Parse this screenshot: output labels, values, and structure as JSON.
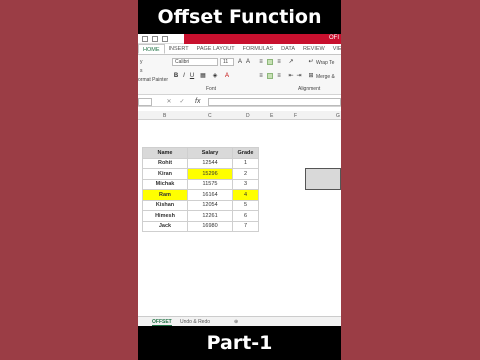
{
  "title": "Offset Function",
  "footer": "Part-1",
  "ribbon_tabs": [
    "HOME",
    "INSERT",
    "PAGE LAYOUT",
    "FORMULAS",
    "DATA",
    "REVIEW",
    "VIEW"
  ],
  "qat_tag": "OFI",
  "ribbon": {
    "font_name": "Calibri",
    "font_size": "11",
    "font_group": "Font",
    "alignment_group": "Alignment",
    "wrap_text": "Wrap Te",
    "merge": "Merge &",
    "paste_partial_1": "y",
    "paste_partial_2": "ormat Painter",
    "clipboard_partial": "s"
  },
  "formula_bar": {
    "fx": "fx"
  },
  "columns": [
    "B",
    "C",
    "D",
    "E",
    "F",
    "G"
  ],
  "table": {
    "headers": [
      "Name",
      "Salary",
      "Grade"
    ],
    "rows": [
      {
        "name": "Rohit",
        "salary": "12544",
        "grade": "1",
        "highlight": false
      },
      {
        "name": "Kiran",
        "salary": "15296",
        "grade": "2",
        "highlight": "salary"
      },
      {
        "name": "Michak",
        "salary": "11575",
        "grade": "3",
        "highlight": false
      },
      {
        "name": "Ram",
        "salary": "16164",
        "grade": "4",
        "highlight": "row"
      },
      {
        "name": "Kishan",
        "salary": "12054",
        "grade": "5",
        "highlight": false
      },
      {
        "name": "Himesh",
        "salary": "12261",
        "grade": "6",
        "highlight": false
      },
      {
        "name": "Jack",
        "salary": "16980",
        "grade": "7",
        "highlight": false
      }
    ]
  },
  "sheet_tabs": [
    "OFFSET",
    "Undo & Redo"
  ],
  "colors": {
    "highlight": "#ffff00",
    "accent": "#217346",
    "background": "#9b3d45"
  }
}
